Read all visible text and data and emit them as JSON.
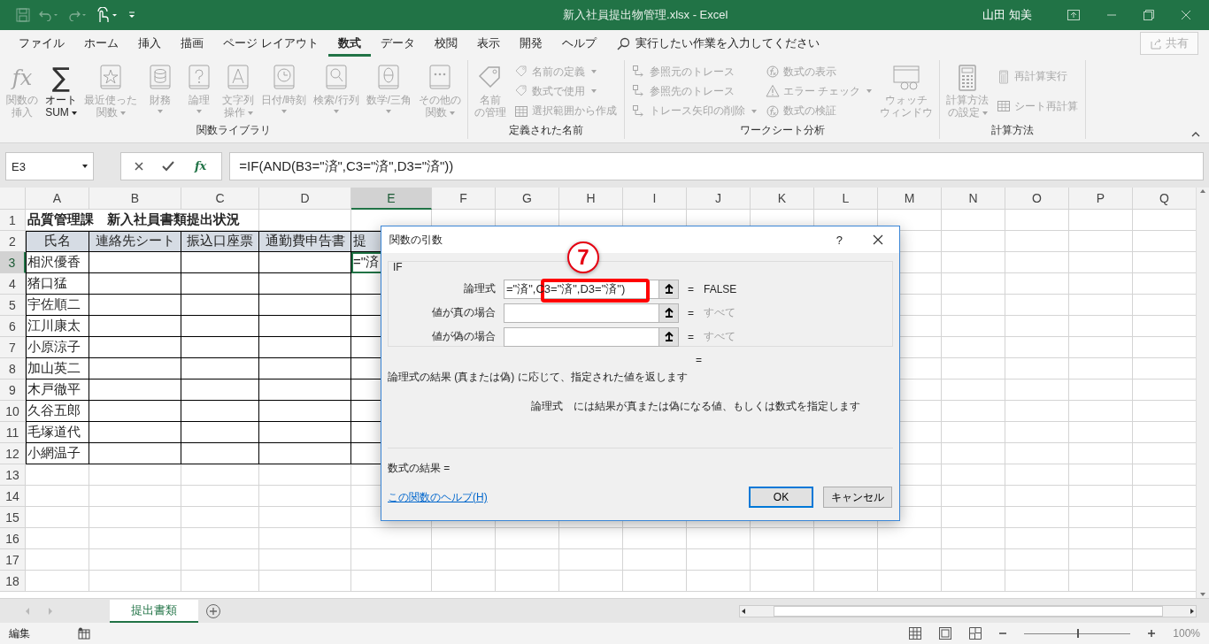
{
  "title_bar": {
    "document_title": "新入社員提出物管理.xlsx  -  Excel",
    "user": "山田 知美"
  },
  "ribbon_tabs": [
    {
      "label": "ファイル",
      "selected": false
    },
    {
      "label": "ホーム",
      "selected": false
    },
    {
      "label": "挿入",
      "selected": false
    },
    {
      "label": "描画",
      "selected": false
    },
    {
      "label": "ページ レイアウト",
      "selected": false
    },
    {
      "label": "数式",
      "selected": true
    },
    {
      "label": "データ",
      "selected": false
    },
    {
      "label": "校閲",
      "selected": false
    },
    {
      "label": "表示",
      "selected": false
    },
    {
      "label": "開発",
      "selected": false
    },
    {
      "label": "ヘルプ",
      "selected": false
    }
  ],
  "tell_me": {
    "label": "実行したい作業を入力してください"
  },
  "share_button": {
    "label": "共有",
    "disabled": true
  },
  "ribbon_groups": [
    {
      "label": "関数ライブラリ",
      "items": [
        {
          "kind": "large",
          "glyph": "fx",
          "label": "関数の挿入",
          "disabled": true,
          "menu": false
        },
        {
          "kind": "large",
          "glyph": "∑",
          "label": "オートSUM",
          "disabled": false,
          "menu": true
        },
        {
          "kind": "large",
          "label": "最近使った関数",
          "disabled": true,
          "menu": true
        },
        {
          "kind": "large",
          "label": "財務",
          "disabled": true,
          "menu": true
        },
        {
          "kind": "large",
          "label": "論理",
          "disabled": true,
          "menu": true
        },
        {
          "kind": "large",
          "label": "文字列操作",
          "disabled": true,
          "menu": true
        },
        {
          "kind": "large",
          "label": "日付/時刻",
          "disabled": true,
          "menu": true
        },
        {
          "kind": "large",
          "label": "検索/行列",
          "disabled": true,
          "menu": true
        },
        {
          "kind": "large",
          "label": "数学/三角",
          "disabled": true,
          "menu": true
        },
        {
          "kind": "large",
          "label": "その他の関数",
          "disabled": true,
          "menu": true
        }
      ]
    },
    {
      "label": "定義された名前",
      "items": [
        {
          "kind": "large",
          "label": "名前の管理",
          "disabled": true,
          "menu": false
        },
        {
          "kind": "small",
          "label": "名前の定義",
          "disabled": true,
          "menu": true
        },
        {
          "kind": "small",
          "label": "数式で使用",
          "disabled": true,
          "menu": true
        },
        {
          "kind": "small",
          "label": "選択範囲から作成",
          "disabled": true,
          "menu": false
        }
      ]
    },
    {
      "label": "ワークシート分析",
      "items": [
        {
          "kind": "small",
          "label": "参照元のトレース",
          "disabled": true,
          "menu": false
        },
        {
          "kind": "small",
          "label": "参照先のトレース",
          "disabled": true,
          "menu": false
        },
        {
          "kind": "small",
          "label": "トレース矢印の削除",
          "disabled": true,
          "menu": true
        },
        {
          "kind": "small",
          "label": "数式の表示",
          "disabled": true,
          "menu": false
        },
        {
          "kind": "small",
          "label": "エラー チェック",
          "disabled": true,
          "menu": true
        },
        {
          "kind": "small",
          "label": "数式の検証",
          "disabled": true,
          "menu": false
        },
        {
          "kind": "large",
          "label": "ウォッチウィンドウ",
          "disabled": true,
          "menu": false
        }
      ]
    },
    {
      "label": "計算方法",
      "items": [
        {
          "kind": "large",
          "label": "計算方法の設定",
          "disabled": true,
          "menu": true
        },
        {
          "kind": "small",
          "label": "再計算実行",
          "disabled": true,
          "menu": false
        },
        {
          "kind": "small",
          "label": "シート再計算",
          "disabled": true,
          "menu": false
        }
      ]
    }
  ],
  "formula_bar": {
    "name_box": "E3",
    "insert_function": "fx",
    "formula": "=IF(AND(B3=\"済\",C3=\"済\",D3=\"済\"))"
  },
  "columns": [
    {
      "letter": "A",
      "selected": false
    },
    {
      "letter": "B",
      "selected": false
    },
    {
      "letter": "C",
      "selected": false
    },
    {
      "letter": "D",
      "selected": false
    },
    {
      "letter": "E",
      "selected": true
    },
    {
      "letter": "F",
      "selected": false
    },
    {
      "letter": "G",
      "selected": false
    },
    {
      "letter": "H",
      "selected": false
    },
    {
      "letter": "I",
      "selected": false
    },
    {
      "letter": "J",
      "selected": false
    },
    {
      "letter": "K",
      "selected": false
    },
    {
      "letter": "L",
      "selected": false
    },
    {
      "letter": "M",
      "selected": false
    },
    {
      "letter": "N",
      "selected": false
    },
    {
      "letter": "O",
      "selected": false
    },
    {
      "letter": "P",
      "selected": false
    },
    {
      "letter": "Q",
      "selected": false
    }
  ],
  "rows": [
    {
      "number": "1",
      "selected": false,
      "kind": "title",
      "cells": {
        "A": "品質管理課　新入社員書類提出状況"
      }
    },
    {
      "number": "2",
      "selected": false,
      "kind": "header",
      "cells": {
        "A": "氏名",
        "B": "連絡先シート",
        "C": "振込口座票",
        "D": "通勤費申告書",
        "E": "提"
      }
    },
    {
      "number": "3",
      "selected": true,
      "kind": "data",
      "cells": {
        "A": "相沢優香",
        "E": "=\"済"
      }
    },
    {
      "number": "4",
      "selected": false,
      "kind": "data",
      "cells": {
        "A": "猪口猛"
      }
    },
    {
      "number": "5",
      "selected": false,
      "kind": "data",
      "cells": {
        "A": "宇佐順二"
      }
    },
    {
      "number": "6",
      "selected": false,
      "kind": "data",
      "cells": {
        "A": "江川康太"
      }
    },
    {
      "number": "7",
      "selected": false,
      "kind": "data",
      "cells": {
        "A": "小原涼子"
      }
    },
    {
      "number": "8",
      "selected": false,
      "kind": "data",
      "cells": {
        "A": "加山英二"
      }
    },
    {
      "number": "9",
      "selected": false,
      "kind": "data",
      "cells": {
        "A": "木戸徹平"
      }
    },
    {
      "number": "10",
      "selected": false,
      "kind": "data",
      "cells": {
        "A": "久谷五郎"
      }
    },
    {
      "number": "11",
      "selected": false,
      "kind": "data",
      "cells": {
        "A": "毛塚道代"
      }
    },
    {
      "number": "12",
      "selected": false,
      "kind": "data",
      "cells": {
        "A": "小網温子"
      }
    },
    {
      "number": "13",
      "selected": false,
      "kind": "blank"
    },
    {
      "number": "14",
      "selected": false,
      "kind": "blank"
    },
    {
      "number": "15",
      "selected": false,
      "kind": "blank"
    },
    {
      "number": "16",
      "selected": false,
      "kind": "blank"
    },
    {
      "number": "17",
      "selected": false,
      "kind": "blank"
    },
    {
      "number": "18",
      "selected": false,
      "kind": "blank"
    }
  ],
  "dialog": {
    "title": "関数の引数",
    "help": "?",
    "function_name": "IF",
    "arguments": [
      {
        "label": "論理式",
        "value": "=\"済\",C3=\"済\",D3=\"済\")",
        "equals": "=",
        "result": "FALSE",
        "dimmed": false
      },
      {
        "label": "値が真の場合",
        "equals": "=",
        "result": "すべて",
        "dimmed": true
      },
      {
        "label": "値が偽の場合",
        "equals": "=",
        "result": "すべて",
        "dimmed": true
      }
    ],
    "function_equals": "=",
    "description": "論理式の結果 (真または偽) に応じて、指定された値を返します",
    "argument_name": "論理式",
    "argument_help": "には結果が真または偽になる値、もしくは数式を指定します",
    "formula_result": "数式の結果 =",
    "help_link": "この関数のヘルプ(H)",
    "buttons": [
      "OK",
      "キャンセル"
    ]
  },
  "annotation": {
    "step": "7"
  },
  "sheet_tabs": [
    {
      "label": "提出書類",
      "selected": true
    }
  ],
  "status_bar": {
    "mode": "編集",
    "zoom": {
      "level": 0.5,
      "reading": "100%"
    }
  }
}
